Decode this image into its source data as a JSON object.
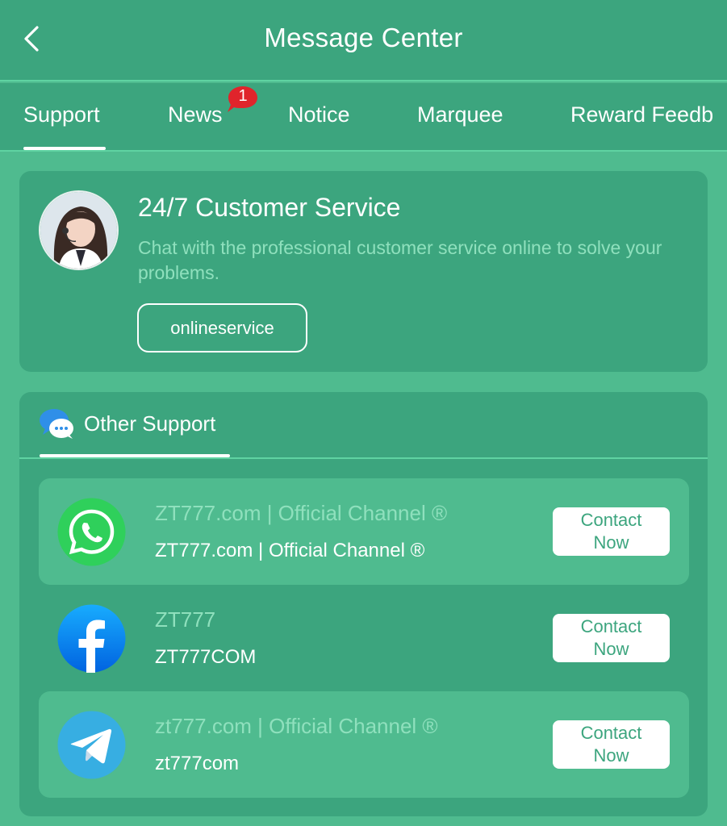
{
  "header": {
    "title": "Message Center"
  },
  "tabs": [
    {
      "label": "Support"
    },
    {
      "label": "News",
      "badge": "1"
    },
    {
      "label": "Notice"
    },
    {
      "label": "Marquee"
    },
    {
      "label": "Reward Feedb"
    }
  ],
  "customer_service": {
    "title": "24/7 Customer Service",
    "description": "Chat with the professional customer service online to solve your problems.",
    "button_label": "onlineservice"
  },
  "other_support": {
    "title": "Other Support",
    "items": [
      {
        "icon": "whatsapp-icon",
        "name": "ZT777.com | Official Channel ®",
        "sub": "ZT777.com | Official Channel ®",
        "button": "Contact Now"
      },
      {
        "icon": "facebook-icon",
        "name": "ZT777",
        "sub": "ZT777COM",
        "button": "Contact Now"
      },
      {
        "icon": "telegram-icon",
        "name": "zt777.com | Official Channel ®",
        "sub": "zt777com",
        "button": "Contact Now"
      }
    ]
  },
  "colors": {
    "header_bg": "#3ca57e",
    "page_bg": "#4fbb8f",
    "muted_text": "#8fe0bd",
    "badge_red": "#e0242b"
  }
}
